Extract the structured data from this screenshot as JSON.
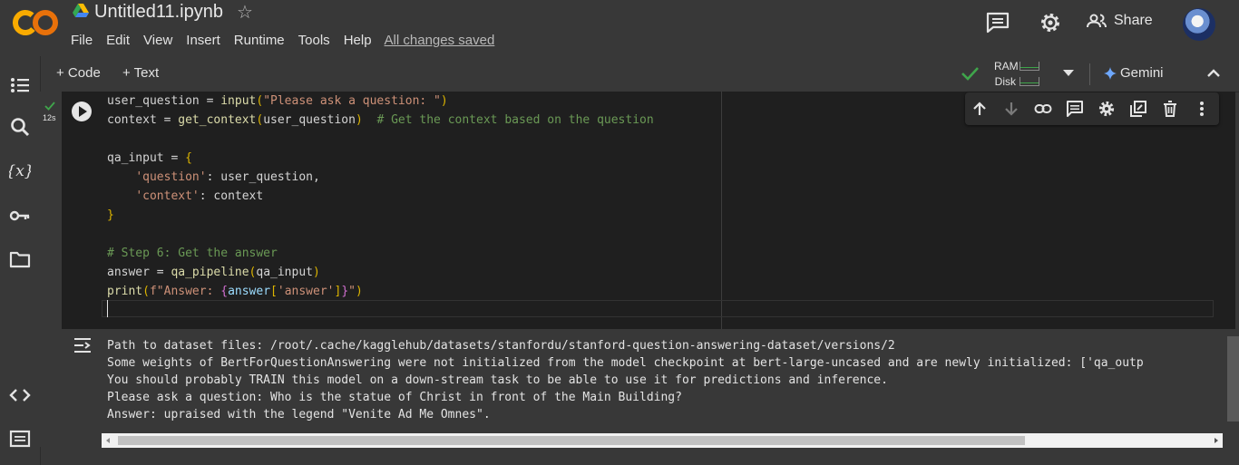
{
  "header": {
    "title": "Untitled11.ipynb",
    "menu": [
      "File",
      "Edit",
      "View",
      "Insert",
      "Runtime",
      "Tools",
      "Help"
    ],
    "save_status": "All changes saved",
    "share_label": "Share"
  },
  "toolbar": {
    "add_code_label": "+ Code",
    "add_text_label": "+ Text",
    "ram_label": "RAM",
    "disk_label": "Disk",
    "gemini_label": "Gemini"
  },
  "cell": {
    "exec_time": "12s",
    "code_lines": [
      "user_question = input(\"Please ask a question: \")",
      "context = get_context(user_question)  # Get the context based on the question",
      "",
      "qa_input = {",
      "    'question': user_question,",
      "    'context': context",
      "}",
      "",
      "# Step 6: Get the answer",
      "answer = qa_pipeline(qa_input)",
      "print(f\"Answer: {answer['answer']}\")",
      ""
    ],
    "output_lines": [
      "Path to dataset files: /root/.cache/kagglehub/datasets/stanfordu/stanford-question-answering-dataset/versions/2",
      "Some weights of BertForQuestionAnswering were not initialized from the model checkpoint at bert-large-uncased and are newly initialized: ['qa_outp",
      "You should probably TRAIN this model on a down-stream task to be able to use it for predictions and inference.",
      "Please ask a question: Who is the statue of Christ in front of the Main Building?",
      "Answer: upraised with the legend \"Venite Ad Me Omnes\"."
    ]
  },
  "colors": {
    "background": "#383838",
    "editor": "#1f1f1f",
    "accent_green": "#3fa54b",
    "logo_orange": "#f9ab00"
  }
}
